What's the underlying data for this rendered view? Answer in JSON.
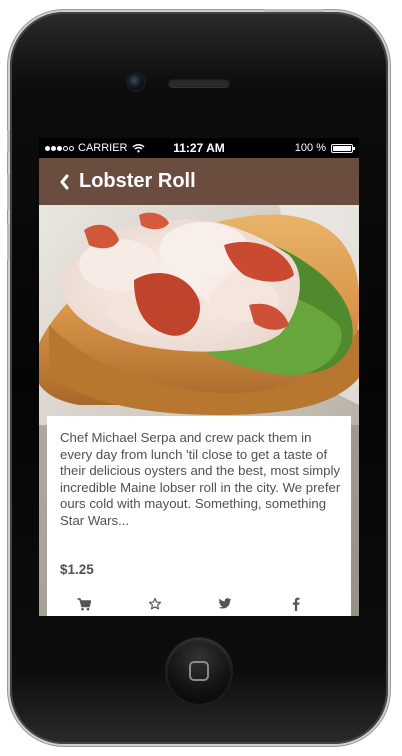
{
  "status_bar": {
    "carrier": "CARRIER",
    "time": "11:27 AM",
    "battery": "100 %",
    "battery_level": 1.0
  },
  "nav": {
    "title": "Lobster Roll",
    "back_icon": "chevron-left-icon"
  },
  "product": {
    "description": "Chef Michael Serpa and crew pack them in every day from lunch 'til close to get a taste of their delicious oysters and the best, most simply incredible Maine lobser roll in the city. We prefer ours cold with mayout. Something, something Star Wars...",
    "price": "$1.25"
  },
  "actions": [
    {
      "icon": "cart-icon"
    },
    {
      "icon": "star-icon"
    },
    {
      "icon": "twitter-icon"
    },
    {
      "icon": "facebook-icon"
    }
  ],
  "colors": {
    "nav_background": "#6b4d40",
    "text": "#505050",
    "icon": "#555555"
  }
}
